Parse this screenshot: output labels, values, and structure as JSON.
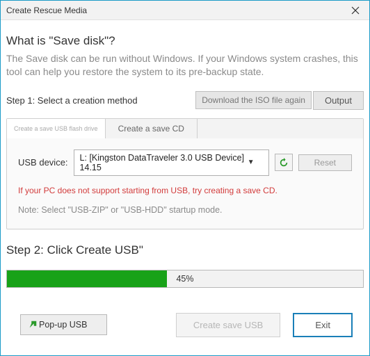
{
  "window": {
    "title": "Create Rescue Media"
  },
  "intro": {
    "heading": "What is \"Save disk\"?",
    "desc": "The Save disk can be run without Windows. If your Windows system crashes, this tool can help you restore the system to its pre-backup state."
  },
  "step1": {
    "label": "Step 1: Select a creation method",
    "download_label": "Download the ISO file again",
    "output_label": "Output"
  },
  "tabs": {
    "usb_label": "Create a save USB flash drive",
    "cd_label": "Create a save CD"
  },
  "usb_panel": {
    "device_label": "USB device:",
    "device_value": "L: [Kingston DataTraveler 3.0 USB Device] 14.15",
    "reset_label": "Reset",
    "warning": "If your PC does not support starting from USB, try creating a save CD.",
    "note": "Note: Select \"USB-ZIP\" or \"USB-HDD\" startup mode."
  },
  "step2": {
    "heading": "Step 2: Click Create USB\"",
    "progress_percent": 45,
    "progress_text": "45%"
  },
  "buttons": {
    "popup_label": "Pop-up USB",
    "create_label": "Create save USB",
    "exit_label": "Exit"
  }
}
